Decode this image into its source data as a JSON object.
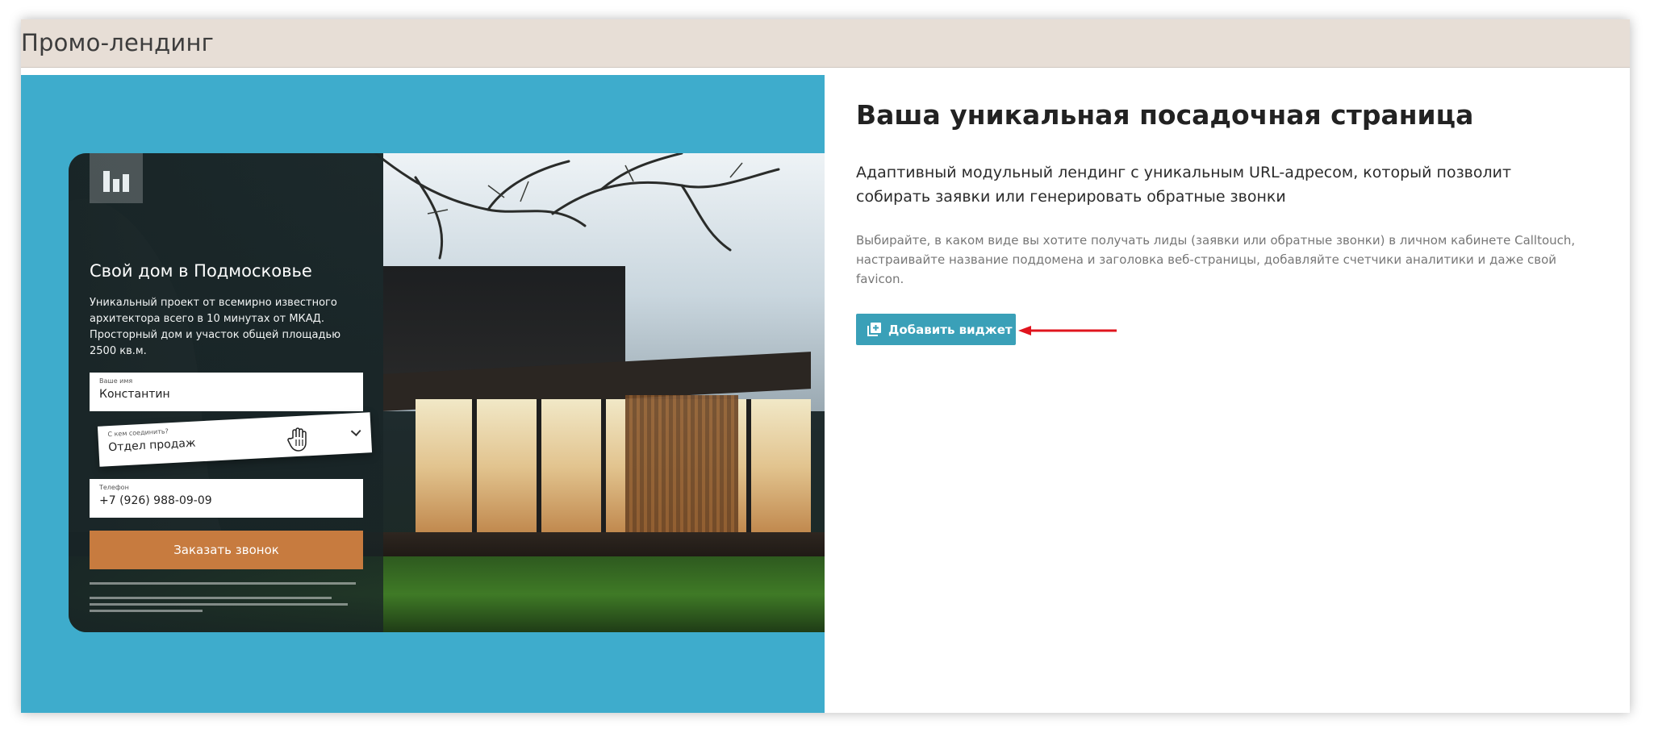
{
  "header": {
    "title": "Промо-лендинг"
  },
  "preview": {
    "title": "Свой дом в Подмосковье",
    "description": "Уникальный проект от всемирно известного архитектора всего в 10 минутах от МКАД. Просторный дом и участок общей площадью 2500 кв.м.",
    "fields": {
      "name": {
        "label": "Ваше имя",
        "value": "Константин"
      },
      "department": {
        "label": "С кем соединить?",
        "value": "Отдел продаж"
      },
      "phone": {
        "label": "Телефон",
        "value": "+7 (926) 988-09-09"
      }
    },
    "submit_label": "Заказать звонок"
  },
  "info": {
    "title": "Ваша уникальная посадочная страница",
    "subtitle": "Адаптивный модульный лендинг с уникальным URL-адресом, который позволит собирать заявки или генерировать обратные звонки",
    "description": "Выбирайте, в каком виде вы хотите получать лиды (заявки или обратные звонки) в личном кабинете Calltouch, настраивайте название поддомена и заголовка веб-страницы, добавляйте счетчики аналитики и даже свой favicon.",
    "add_button_label": "Добавить виджет",
    "add_button_icon": "add-widget-icon"
  },
  "colors": {
    "header_bg": "#e7ded6",
    "preview_panel_bg": "#3eaccc",
    "button_bg": "#3aa0b8",
    "cta_orange": "#c77b3f",
    "arrow_red": "#e0141e"
  }
}
